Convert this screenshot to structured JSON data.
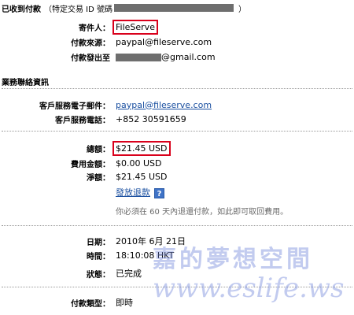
{
  "header": {
    "title": "已收到付款",
    "paren_prefix": "（特定交易 ID 號碼",
    "paren_suffix": "）"
  },
  "sender": {
    "sender_label": "寄件人：",
    "sender_value": "FileServe",
    "source_label": "付款來源：",
    "source_value": "paypal@fileserve.com",
    "to_label": "付款發出至",
    "to_value_suffix": "@gmail.com"
  },
  "contact": {
    "section_title": "業務聯絡資訊",
    "email_label": "客戶服務電子郵件：",
    "email_value": "paypal@fileserve.com",
    "phone_label": "客戶服務電話：",
    "phone_value": "+852 30591659"
  },
  "amounts": {
    "total_label": "總額：",
    "total_value": "$21.45 USD",
    "fee_label": "費用金額：",
    "fee_value": "$0.00 USD",
    "net_label": "淨額：",
    "net_value": "$21.45 USD",
    "refund_link": "發放退款",
    "help_icon_glyph": "?",
    "refund_note": "你必須在 60 天內退還付款，如此即可取回費用。"
  },
  "details": {
    "date_label": "日期：",
    "date_value": "2010年 6月 21日",
    "time_label": "時間：",
    "time_value": "18:10:08 HKT",
    "status_label": "狀態：",
    "status_value": "已完成",
    "type_label": "付款類型：",
    "type_value": "即時"
  },
  "watermark": {
    "chinese": "嘉的夢想空間",
    "english": "www.eslife.ws"
  }
}
